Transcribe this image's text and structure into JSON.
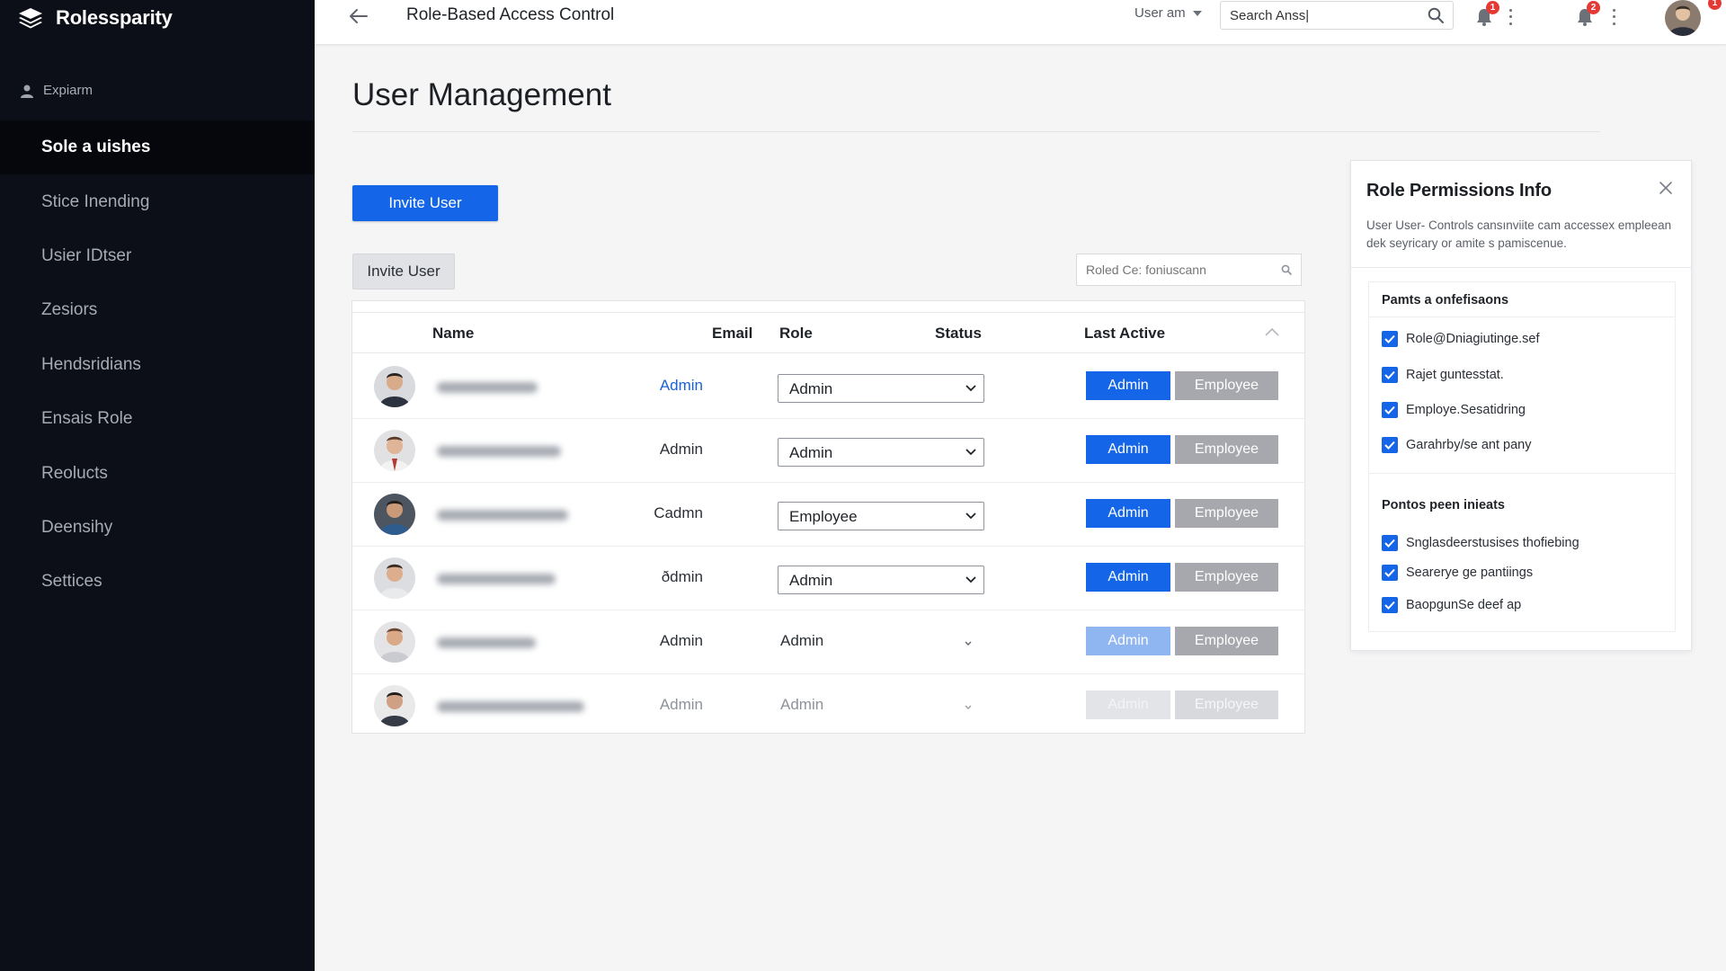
{
  "app": {
    "brand": "Rolessparity"
  },
  "sidebar": {
    "section_label": "Expiarm",
    "items": [
      {
        "label": "Sole a uishes",
        "active": true
      },
      {
        "label": "Stice Inending",
        "active": false
      },
      {
        "label": "Usier IDtser",
        "active": false
      },
      {
        "label": "Zesiors",
        "active": false
      },
      {
        "label": "Hendsridians",
        "active": false
      },
      {
        "label": "Ensais Role",
        "active": false
      },
      {
        "label": "Reolucts",
        "active": false
      },
      {
        "label": "Deensihy",
        "active": false
      },
      {
        "label": "Settices",
        "active": false
      }
    ]
  },
  "topbar": {
    "title": "Role-Based Access Control",
    "user_menu": "User am",
    "search_value": "Search Anss|",
    "badge_1": "1",
    "badge_2": "2",
    "badge_3": "1"
  },
  "main": {
    "page_title": "User Management",
    "invite_primary": "Invite User",
    "invite_secondary": "Invite User",
    "filter_placeholder": "Roled Ce: foniuscann"
  },
  "table": {
    "headers": {
      "name": "Name",
      "email": "Email",
      "role": "Role",
      "status": "Status",
      "last_active": "Last Active"
    },
    "rows": [
      {
        "email": "Admin",
        "role": "Admin",
        "admin_btn": "Admin",
        "employee_btn": "Employee"
      },
      {
        "email": "Admin",
        "role": "Admin",
        "admin_btn": "Admin",
        "employee_btn": "Employee"
      },
      {
        "email": "Cadmn",
        "role": "Employee",
        "admin_btn": "Admin",
        "employee_btn": "Employee"
      },
      {
        "email": "ðdmin",
        "role": "Admin",
        "admin_btn": "Admin",
        "employee_btn": "Employee"
      },
      {
        "email": "Admin",
        "role": "Admin",
        "admin_btn": "Admin",
        "employee_btn": "Employee"
      },
      {
        "email": "Admin",
        "role": "Admin",
        "admin_btn": "Admin",
        "employee_btn": "Employee"
      }
    ]
  },
  "panel": {
    "title": "Role Permissions Info",
    "description": "User User- Controls cansınviite cam accessex empleean dek seyricary or amite s pamiscenue.",
    "group_1": {
      "title": "Pamts a onfefisaons",
      "items": [
        "Role@Dniagiutinge.sef",
        "Rajet guntesstat.",
        "Employe.Sesatidring",
        "Garahrby/se ant pany"
      ]
    },
    "group_2": {
      "title": "Pontos peen inieats",
      "items": [
        "Snglasdeerstusises thofiebing",
        "Searerye ge pantiings",
        "BaopgunSe deef ap"
      ]
    }
  },
  "colors": {
    "primary": "#1565e8",
    "sidebar_bg": "#0c0f18",
    "badge": "#e53935",
    "employee_btn": "#a6a8ad"
  }
}
